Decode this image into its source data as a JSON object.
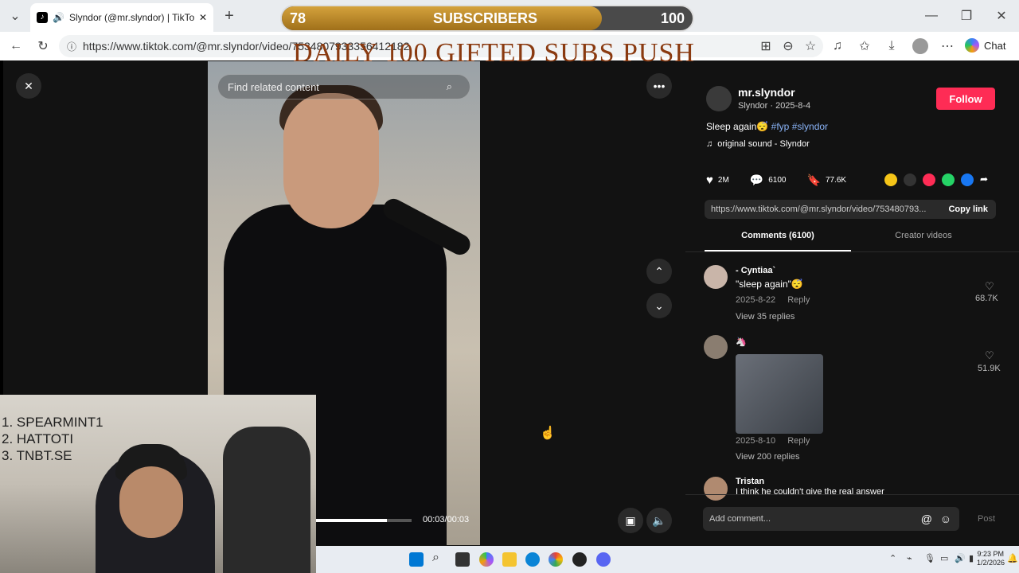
{
  "browser": {
    "tab_title": "Slyndor (@mr.slyndor) | TikTok",
    "url": "https://www.tiktok.com/@mr.slyndor/video/7534807933356412182",
    "copilot_label": "Chat"
  },
  "overlay": {
    "sub_current": "78",
    "sub_label": "SUBSCRIBERS",
    "sub_goal": "100",
    "sub_progress": 0.78,
    "push_text": "DAILY 100 GIFTED SUBS PUSH"
  },
  "video": {
    "search_placeholder": "Find related content",
    "time": "00:03/00:03"
  },
  "post": {
    "username": "mr.slyndor",
    "display_line": "Slyndor · 2025-8-4",
    "follow_label": "Follow",
    "caption": "Sleep again😴",
    "hashtags": "#fyp #slyndor",
    "sound": "original sound - Slyndor",
    "likes": "2M",
    "comments_count": "6100",
    "saves": "77.6K",
    "link": "https://www.tiktok.com/@mr.slyndor/video/753480793...",
    "copy_link_label": "Copy link"
  },
  "tabs": {
    "comments": "Comments (6100)",
    "creator_videos": "Creator videos"
  },
  "comments": [
    {
      "user": "- Cyntiaa`",
      "text": "\"sleep again\"😴",
      "date": "2025-8-22",
      "reply": "Reply",
      "likes": "68.7K",
      "view_replies": "View 35 replies"
    },
    {
      "user": "🦄",
      "text": "",
      "date": "2025-8-10",
      "reply": "Reply",
      "likes": "51.9K",
      "view_replies": "View 200 replies"
    },
    {
      "user": "Tristan",
      "text": "I think he couldn't give the real answer"
    }
  ],
  "add_comment_placeholder": "Add comment...",
  "post_label": "Post",
  "webcam": {
    "leaderboard": [
      "1.  SPEARMINT1",
      "2.    HATTOTI",
      "3.  TNBT.SE"
    ]
  },
  "taskbar": {
    "time": "9:23 PM",
    "date": "1/2/2026"
  }
}
